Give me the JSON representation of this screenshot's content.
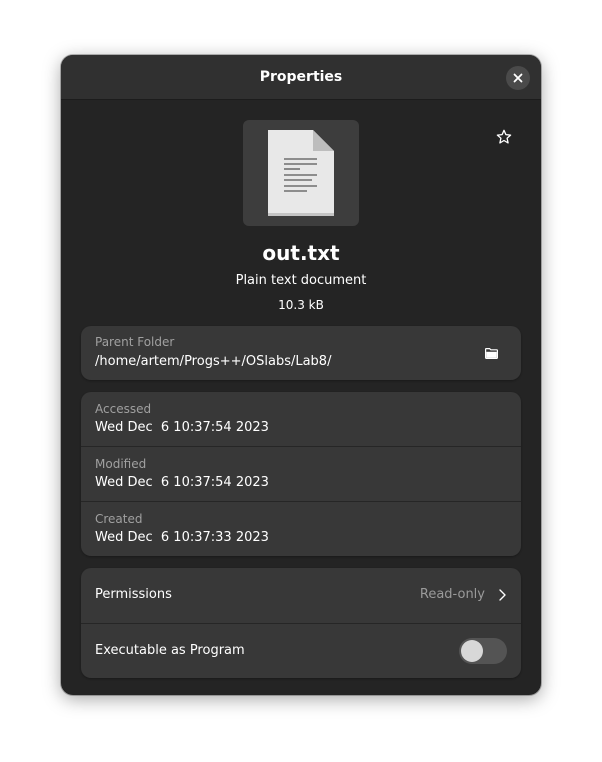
{
  "window": {
    "title": "Properties"
  },
  "file": {
    "icon": "text-document-icon",
    "name": "out.txt",
    "type": "Plain text document",
    "size": "10.3 kB",
    "starred": false
  },
  "parent_folder": {
    "label": "Parent Folder",
    "path": "/home/artem/Progs++/OSlabs/Lab8/"
  },
  "times": [
    {
      "label": "Accessed",
      "value": "Wed Dec  6 10:37:54 2023"
    },
    {
      "label": "Modified",
      "value": "Wed Dec  6 10:37:54 2023"
    },
    {
      "label": "Created",
      "value": "Wed Dec  6 10:37:33 2023"
    }
  ],
  "permissions": {
    "label": "Permissions",
    "value": "Read-only"
  },
  "executable": {
    "label": "Executable as Program",
    "enabled": false
  },
  "colors": {
    "window_bg": "#242424",
    "card_bg": "#383838",
    "secondary_text": "#a0a0a0"
  }
}
